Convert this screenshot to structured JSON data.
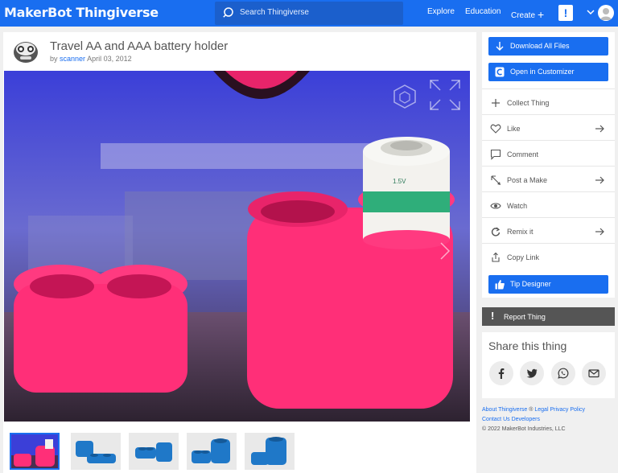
{
  "header": {
    "logo_maker": "MakerBot",
    "logo_thing": "Thingiverse",
    "search_placeholder": "Search Thingiverse",
    "nav": {
      "explore": "Explore",
      "education": "Education",
      "create": "Create"
    },
    "alert_badge": "!"
  },
  "thing": {
    "title": "Travel AA and AAA battery holder",
    "by": "by",
    "author": "scanner",
    "date": "April 03, 2012",
    "battery_label": "1.5V"
  },
  "sidebar": {
    "download_label": "Download All Files",
    "customizer_label": "Open in Customizer",
    "actions": [
      {
        "label": "Collect Thing",
        "icon": "plus-icon",
        "arrow": false
      },
      {
        "label": "Like",
        "icon": "heart-icon",
        "arrow": true
      },
      {
        "label": "Comment",
        "icon": "comment-icon",
        "arrow": false
      },
      {
        "label": "Post a Make",
        "icon": "make-icon",
        "arrow": true
      },
      {
        "label": "Watch",
        "icon": "eye-icon",
        "arrow": false
      },
      {
        "label": "Remix it",
        "icon": "remix-icon",
        "arrow": true
      },
      {
        "label": "Copy Link",
        "icon": "share-icon",
        "arrow": false
      }
    ],
    "tip_label": "Tip Designer",
    "report_label": "Report Thing",
    "report_icon": "!"
  },
  "share": {
    "title": "Share this thing",
    "networks": [
      "facebook-icon",
      "twitter-icon",
      "whatsapp-icon",
      "email-icon"
    ]
  },
  "footer": {
    "about": "About Thingiverse",
    "registered": "®",
    "legal": "Legal",
    "privacy": "Privacy Policy",
    "contact": "Contact Us",
    "developers": "Developers",
    "copyright": "© 2022 MakerBot Industries, LLC"
  },
  "colors": {
    "brand_blue": "#196ef0",
    "report_gray": "#555555",
    "print_pink": "#ff2f78"
  }
}
